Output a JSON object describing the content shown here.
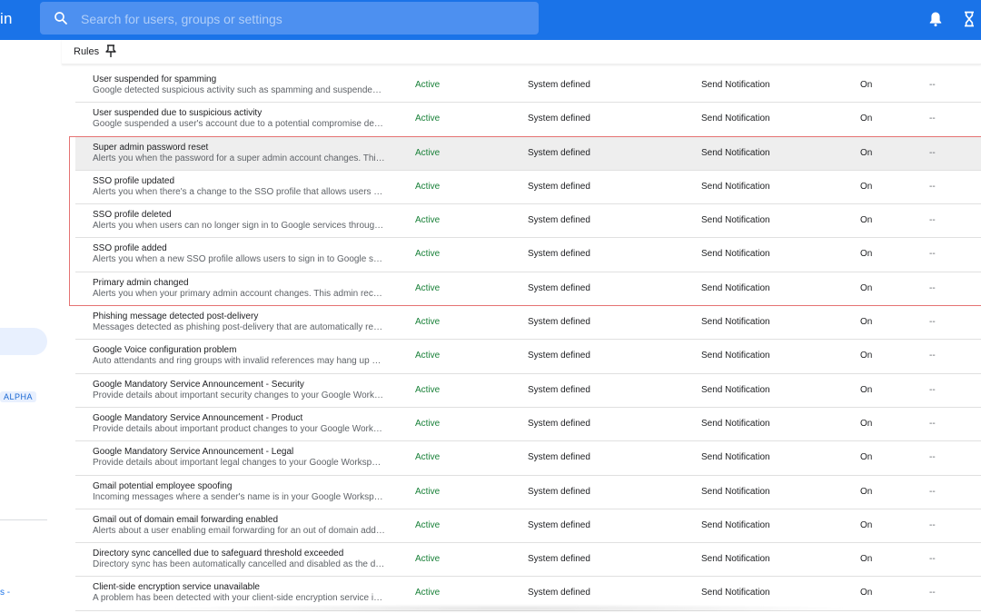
{
  "app": {
    "brand_fragment": "in"
  },
  "search": {
    "placeholder": "Search for users, groups or settings"
  },
  "sidebar": {
    "alpha_badge": "ALPHA",
    "link_fragment": "s -"
  },
  "rules": {
    "title": "Rules",
    "rows": [
      {
        "name": "User suspended for spamming",
        "description": "Google detected suspicious activity such as spamming and suspended ...",
        "status": "Active",
        "type": "System defined",
        "action": "Send Notification",
        "state": "On",
        "extra": "--"
      },
      {
        "name": "User suspended due to suspicious activity",
        "description": "Google suspended a user's account due to a potential compromise dete...",
        "status": "Active",
        "type": "System defined",
        "action": "Send Notification",
        "state": "On",
        "extra": "--"
      },
      {
        "name": "Super admin password reset",
        "description": "Alerts you when the password for a super admin account changes. This ...",
        "status": "Active",
        "type": "System defined",
        "action": "Send Notification",
        "state": "On",
        "extra": "--"
      },
      {
        "name": "SSO profile updated",
        "description": "Alerts you when there's a change to the SSO profile that allows users to ...",
        "status": "Active",
        "type": "System defined",
        "action": "Send Notification",
        "state": "On",
        "extra": "--"
      },
      {
        "name": "SSO profile deleted",
        "description": "Alerts you when users can no longer sign in to Google services through ...",
        "status": "Active",
        "type": "System defined",
        "action": "Send Notification",
        "state": "On",
        "extra": "--"
      },
      {
        "name": "SSO profile added",
        "description": "Alerts you when a new SSO profile allows users to sign in to Google serv...",
        "status": "Active",
        "type": "System defined",
        "action": "Send Notification",
        "state": "On",
        "extra": "--"
      },
      {
        "name": "Primary admin changed",
        "description": "Alerts you when your primary admin account changes. This admin recei...",
        "status": "Active",
        "type": "System defined",
        "action": "Send Notification",
        "state": "On",
        "extra": "--"
      },
      {
        "name": "Phishing message detected post-delivery",
        "description": "Messages detected as phishing post-delivery that are automatically recl...",
        "status": "Active",
        "type": "System defined",
        "action": "Send Notification",
        "state": "On",
        "extra": "--"
      },
      {
        "name": "Google Voice configuration problem",
        "description": "Auto attendants and ring groups with invalid references may hang up at ...",
        "status": "Active",
        "type": "System defined",
        "action": "Send Notification",
        "state": "On",
        "extra": "--"
      },
      {
        "name": "Google Mandatory Service Announcement - Security",
        "description": "Provide details about important security changes to your Google Works...",
        "status": "Active",
        "type": "System defined",
        "action": "Send Notification",
        "state": "On",
        "extra": "--"
      },
      {
        "name": "Google Mandatory Service Announcement - Product",
        "description": "Provide details about important product changes to your Google Works...",
        "status": "Active",
        "type": "System defined",
        "action": "Send Notification",
        "state": "On",
        "extra": "--"
      },
      {
        "name": "Google Mandatory Service Announcement - Legal",
        "description": "Provide details about important legal changes to your Google Workspac...",
        "status": "Active",
        "type": "System defined",
        "action": "Send Notification",
        "state": "On",
        "extra": "--"
      },
      {
        "name": "Gmail potential employee spoofing",
        "description": "Incoming messages where a sender's name is in your Google Workspac...",
        "status": "Active",
        "type": "System defined",
        "action": "Send Notification",
        "state": "On",
        "extra": "--"
      },
      {
        "name": "Gmail out of domain email forwarding enabled",
        "description": "Alerts about a user enabling email forwarding for an out of domain addr...",
        "status": "Active",
        "type": "System defined",
        "action": "Send Notification",
        "state": "On",
        "extra": "--"
      },
      {
        "name": "Directory sync cancelled due to safeguard threshold exceeded",
        "description": "Directory sync has been automatically cancelled and disabled as the dir...",
        "status": "Active",
        "type": "System defined",
        "action": "Send Notification",
        "state": "On",
        "extra": "--"
      },
      {
        "name": "Client-side encryption service unavailable",
        "description": "A problem has been detected with your client-side encryption service in...",
        "status": "Active",
        "type": "System defined",
        "action": "Send Notification",
        "state": "On",
        "extra": "--"
      }
    ]
  },
  "colors": {
    "brand_blue": "#1a73e8",
    "status_active": "#188038",
    "selection_border": "#e57373",
    "highlight_row": "#eeeeee"
  },
  "icons": {
    "search": "search-icon",
    "notifications": "bell-icon",
    "tasks": "hourglass-icon",
    "pin": "pin-icon"
  }
}
